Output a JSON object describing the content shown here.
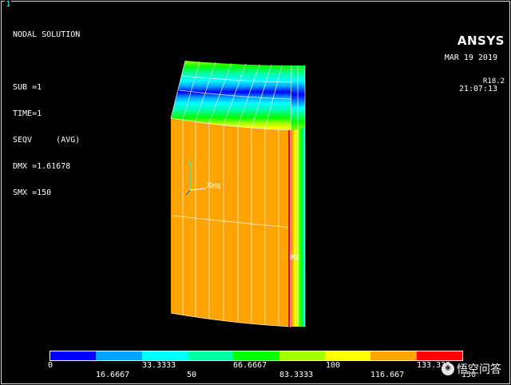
{
  "window": {
    "number": "1"
  },
  "info": {
    "lines": [
      "NODAL SOLUTION",
      "",
      "SUB =1",
      "TIME=1",
      "SEQV     (AVG)",
      "DMX =1.61678",
      "SMX =150"
    ]
  },
  "brand": {
    "name": "ANSYS",
    "version": "R18.2"
  },
  "stamp": {
    "date": "MAR 19 2019",
    "time": "21:07:13"
  },
  "model": {
    "axis_y": "Y",
    "axis_x": "X",
    "min_label": "MN",
    "max_label": "MX"
  },
  "legend": {
    "colors": [
      "#0000ff",
      "#00a3ff",
      "#00ffff",
      "#00ffa3",
      "#00ff00",
      "#a3ff00",
      "#ffff00",
      "#ffa300",
      "#ff0000"
    ],
    "values_row1": [
      "0",
      "33.3333",
      "66.6667",
      "100",
      "133.333"
    ],
    "values_row2": [
      "16.6667",
      "50",
      "83.3333",
      "116.667",
      "150"
    ]
  },
  "watermark": {
    "text": "悟空问答"
  }
}
